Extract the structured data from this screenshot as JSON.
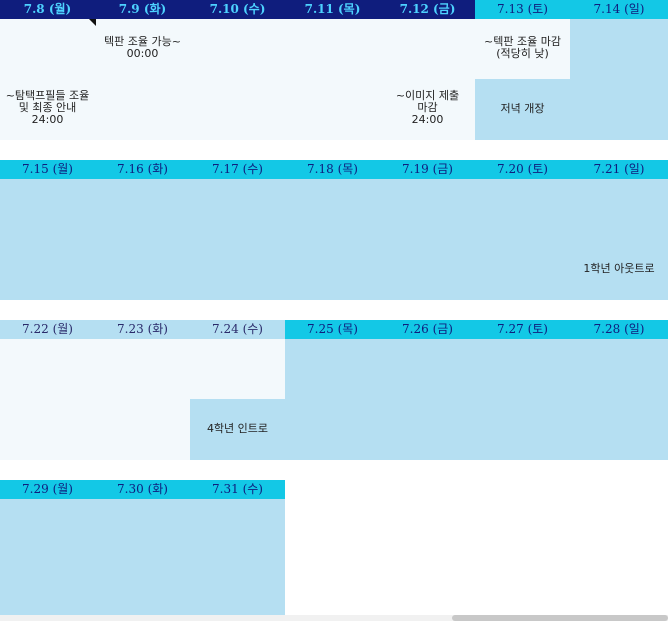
{
  "weeks": [
    {
      "days": [
        "7.8 (월)",
        "7.9 (화)",
        "7.10 (수)",
        "7.11 (목)",
        "7.12 (금)",
        "7.13 (토)",
        "7.14 (일)"
      ],
      "events": {
        "e1": [
          "텍판 조율 가능~",
          "00:00"
        ],
        "e2": [
          "~텍판 조율 마감",
          "(적당히 낮)"
        ],
        "e3": [
          "~탐택프필들 조율",
          "및 최종 안내",
          "24:00"
        ],
        "e4": [
          "~이미지 제출",
          "마감",
          "24:00"
        ],
        "e5": "저녁 개장"
      }
    },
    {
      "days": [
        "7.15 (월)",
        "7.16 (화)",
        "7.17 (수)",
        "7.18 (목)",
        "7.19 (금)",
        "7.20 (토)",
        "7.21 (일)"
      ],
      "events": {
        "e1": "1학년 아웃트로"
      }
    },
    {
      "days": [
        "7.22 (월)",
        "7.23 (화)",
        "7.24 (수)",
        "7.25 (목)",
        "7.26 (금)",
        "7.27 (토)",
        "7.28 (일)"
      ],
      "events": {
        "e1": "4학년 인트로"
      }
    },
    {
      "days": [
        "7.29 (월)",
        "7.30 (화)",
        "7.31 (수)"
      ],
      "events": {}
    }
  ],
  "colors": {
    "dark_header": "#0f1d7d",
    "cyan_header": "#13c8e6",
    "light_cell": "#b5dff2",
    "pale_cell": "#f3f9fc"
  }
}
